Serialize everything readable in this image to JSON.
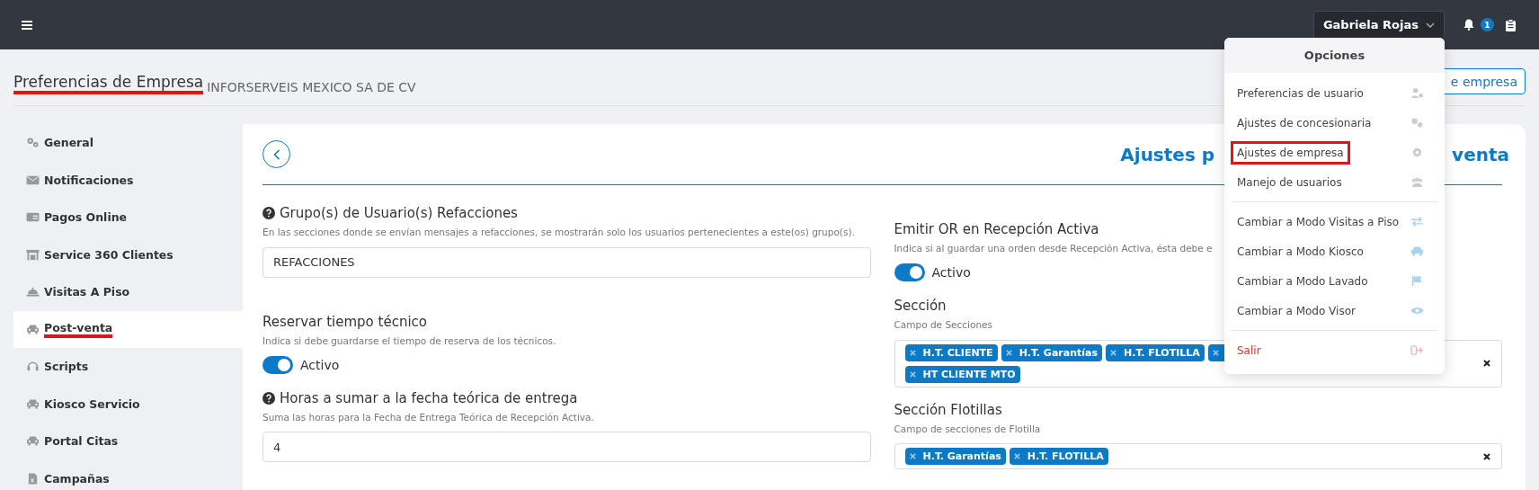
{
  "topbar": {
    "user": "Gabriela Rojas",
    "notifications": "1"
  },
  "header": {
    "title": "Preferencias de Empresa",
    "annotated": true,
    "company": "INFORSERVEIS MEXICO SA DE CV",
    "button": "e empresa"
  },
  "sidebar": [
    {
      "label": "General",
      "selected": false,
      "annotated": false
    },
    {
      "label": "Notificaciones",
      "selected": false,
      "annotated": false
    },
    {
      "label": "Pagos Online",
      "selected": false,
      "annotated": false
    },
    {
      "label": "Service 360 Clientes",
      "selected": false,
      "annotated": false
    },
    {
      "label": "Visitas A Piso",
      "selected": false,
      "annotated": false
    },
    {
      "label": "Post-venta",
      "selected": true,
      "annotated": true
    },
    {
      "label": "Scripts",
      "selected": false,
      "annotated": false
    },
    {
      "label": "Kiosco Servicio",
      "selected": false,
      "annotated": false
    },
    {
      "label": "Portal Citas",
      "selected": false,
      "annotated": false
    },
    {
      "label": "Campañas",
      "selected": false,
      "annotated": false
    }
  ],
  "content": {
    "title_start": "Ajustes p",
    "title_end": "venta",
    "left": [
      {
        "kind": "text",
        "help": true,
        "label": "Grupo(s) de Usuario(s) Refacciones",
        "description": "En las secciones donde se envían mensajes a refacciones, se mostrarán solo los usuarios pertenecientes a este(os) grupo(s).",
        "value": "REFACCIONES"
      },
      {
        "kind": "toggle",
        "help": false,
        "label": "Reservar tiempo técnico",
        "description": "Indica si debe guardarse el tiempo de reserva de los técnicos.",
        "on": true,
        "state_label": "Activo"
      },
      {
        "kind": "text",
        "help": true,
        "label": "Horas a sumar a la fecha teórica de entrega",
        "description": "Suma las horas para la Fecha de Entrega Teórica de Recepción Activa.",
        "value": "4"
      }
    ],
    "right": [
      {
        "kind": "toggle",
        "help": false,
        "label": "Emitir OR en Recepción Activa",
        "description": "Indica si al guardar una orden desde Recepción Activa, ésta debe e",
        "on": true,
        "state_label": "Activo"
      },
      {
        "kind": "chips",
        "help": false,
        "label": "Sección",
        "description": "Campo de Secciones",
        "chips": [
          {
            "kind": "tag",
            "label": "H.T. CLIENTE"
          },
          {
            "kind": "tag",
            "label": "H.T. Garantías"
          },
          {
            "kind": "tag",
            "label": "H.T. FLOTILLA"
          },
          {
            "kind": "covered"
          },
          {
            "kind": "tag",
            "label": "HT CLIENTE MTO"
          }
        ]
      },
      {
        "kind": "chips",
        "help": false,
        "label": "Sección Flotillas",
        "description": "Campo de secciones de Flotilla",
        "chips": [
          {
            "kind": "tag",
            "label": "H.T. Garantías"
          },
          {
            "kind": "tag",
            "label": "H.T. FLOTILLA"
          }
        ]
      }
    ]
  },
  "menu": {
    "title": "Opciones",
    "items": [
      {
        "kind": "link",
        "label": "Preferencias de usuario",
        "annotated": false
      },
      {
        "kind": "link",
        "label": "Ajustes de concesionaria",
        "annotated": false
      },
      {
        "kind": "link",
        "label": "Ajustes de empresa",
        "annotated": true
      },
      {
        "kind": "link",
        "label": "Manejo de usuarios",
        "annotated": false
      },
      {
        "kind": "divider"
      },
      {
        "kind": "mode",
        "label": "Cambiar a Modo Visitas a Piso",
        "annotated": false
      },
      {
        "kind": "mode",
        "label": "Cambiar a Modo Kiosco",
        "annotated": false
      },
      {
        "kind": "mode",
        "label": "Cambiar a Modo Lavado",
        "annotated": false
      },
      {
        "kind": "mode",
        "label": "Cambiar a Modo Visor",
        "annotated": false
      },
      {
        "kind": "divider"
      },
      {
        "kind": "danger",
        "label": "Salir",
        "annotated": false
      }
    ]
  }
}
